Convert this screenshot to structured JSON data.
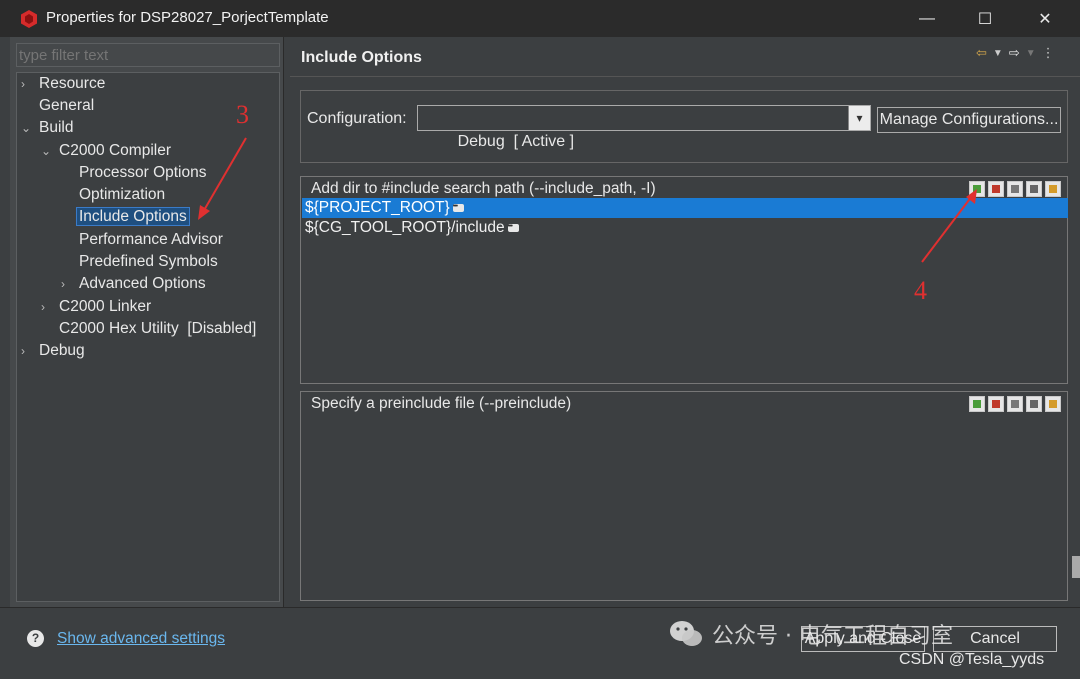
{
  "window": {
    "title": "Properties for DSP28027_PorjectTemplate",
    "controls": {
      "minimize": "—",
      "maximize": "☐",
      "close": "✕"
    }
  },
  "left": {
    "filter_placeholder": "type filter text",
    "tree": [
      {
        "label": "Resource",
        "arrow": "›"
      },
      {
        "label": "General",
        "arrow": ""
      },
      {
        "label": "Build",
        "arrow": "⌄"
      },
      {
        "label": "C2000 Compiler",
        "arrow": "⌄"
      },
      {
        "label": "Processor Options",
        "arrow": ""
      },
      {
        "label": "Optimization",
        "arrow": ""
      },
      {
        "label": "Include Options",
        "arrow": "",
        "selected": true
      },
      {
        "label": "Performance Advisor",
        "arrow": ""
      },
      {
        "label": "Predefined Symbols",
        "arrow": ""
      },
      {
        "label": "Advanced Options",
        "arrow": "›"
      },
      {
        "label": "C2000 Linker",
        "arrow": "›"
      },
      {
        "label": "C2000 Hex Utility  [Disabled]",
        "arrow": ""
      },
      {
        "label": "Debug",
        "arrow": "›"
      }
    ]
  },
  "right": {
    "page_title": "Include Options",
    "configuration": {
      "label": "Configuration:",
      "value": "Debug  [ Active ]",
      "manage_button": "Manage Configurations..."
    },
    "include_paths": {
      "title": "Add dir to #include search path (--include_path, -I)",
      "items": [
        "${PROJECT_ROOT}",
        "${CG_TOOL_ROOT}/include"
      ]
    },
    "preinclude": {
      "title": "Specify a preinclude file (--preinclude)",
      "items": []
    }
  },
  "annotations": {
    "step3": "3",
    "step4": "4"
  },
  "footer": {
    "help": "?",
    "advanced_link": "Show advanced settings",
    "apply_close": "Apply and Close",
    "cancel": "Cancel"
  },
  "watermark": {
    "text": "公众号 · 电气工程自习室",
    "csdn": "CSDN @Tesla_yyds"
  },
  "colors": {
    "accent": "#1a7bd4",
    "annotation": "#e03030",
    "link": "#6ab7ee"
  }
}
